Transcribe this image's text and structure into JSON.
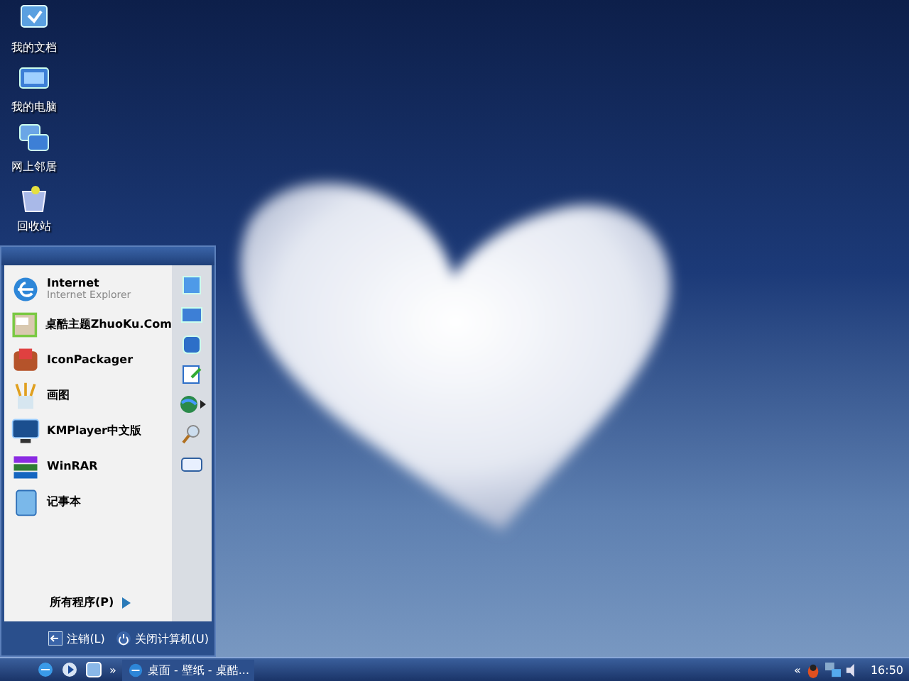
{
  "desktop_icons": [
    {
      "label": "我的文档"
    },
    {
      "label": "我的电脑"
    },
    {
      "label": "网上邻居"
    },
    {
      "label": "回收站"
    }
  ],
  "start_menu": {
    "programs": [
      {
        "title": "Internet",
        "subtitle": "Internet Explorer"
      },
      {
        "title": "桌酷主题ZhuoKu.Com"
      },
      {
        "title": "IconPackager"
      },
      {
        "title": "画图"
      },
      {
        "title": "KMPlayer中文版"
      },
      {
        "title": "WinRAR"
      },
      {
        "title": "记事本"
      }
    ],
    "all_programs": "所有程序(P)",
    "footer_buttons": [
      {
        "label": "注销(L)"
      },
      {
        "label": "关闭计算机(U)"
      }
    ]
  },
  "taskbar": {
    "quick_launch_more": "»",
    "tasks": [
      {
        "label": "桌面 - 壁纸 - 桌酷..."
      }
    ],
    "tray_more": "«",
    "clock": "16:50"
  }
}
